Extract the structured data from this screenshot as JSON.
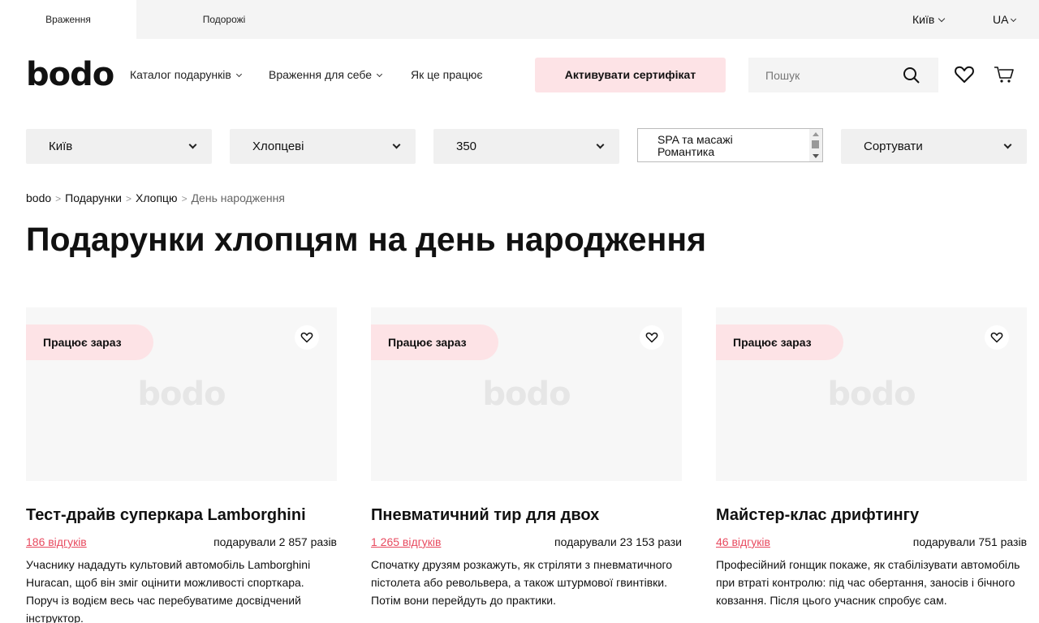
{
  "topbar": {
    "tabs": [
      "Враження",
      "Подорожі"
    ],
    "city": "Київ",
    "lang": "UA"
  },
  "header": {
    "logo": "bodo",
    "nav": [
      "Каталог подарунків",
      "Враження для себе",
      "Як це працює"
    ],
    "activate_label": "Активувати сертифікат",
    "search_placeholder": "Пошук",
    "icons": [
      "search-icon",
      "heart-icon",
      "cart-icon"
    ]
  },
  "filters": {
    "city": "Київ",
    "recipient": "Хлопцеві",
    "price": "350",
    "categories": [
      "SPA та масажі",
      "Романтика"
    ],
    "sort": "Сортувати"
  },
  "breadcrumb": [
    "bodo",
    "Подарунки",
    "Хлопцю",
    "День народження"
  ],
  "page_title": "Подарунки хлопцям на день народження",
  "products": [
    {
      "badge": "Працює зараз",
      "watermark": "bodo",
      "name": "Тест-драйв суперкара Lamborghini",
      "reviews": "186 відгуків",
      "gifted": "подарували 2 857 разів",
      "description": "Учаснику нададуть культовий автомобіль Lamborghini Huracan, щоб він зміг оцінити можливості спорткара. Поруч із водієм весь час перебуватиме досвідчений інструктор."
    },
    {
      "badge": "Працює зараз",
      "watermark": "bodo",
      "name": "Пневматичний тир для двох",
      "reviews": "1 265 відгуків",
      "gifted": "подарували 23 153 рази",
      "description": "Спочатку друзям розкажуть, як стріляти з пневматичного пістолета або револьвера, а також штурмової гвинтівки. Потім вони перейдуть до практики."
    },
    {
      "badge": "Працює зараз",
      "watermark": "bodo",
      "name": "Майстер-клас дрифтингу",
      "reviews": "46 відгуків",
      "gifted": "подарували 751 разів",
      "description": "Професійний гонщик покаже, як стабілізувати автомобіль при втраті контролю: під час обертання, заносів і бічного ковзання. Після цього учасник спробує сам."
    }
  ],
  "colors": {
    "accent_pink": "#fde3e6",
    "link_red": "#e84a5f",
    "topbar_bg": "#f4f4f4"
  }
}
